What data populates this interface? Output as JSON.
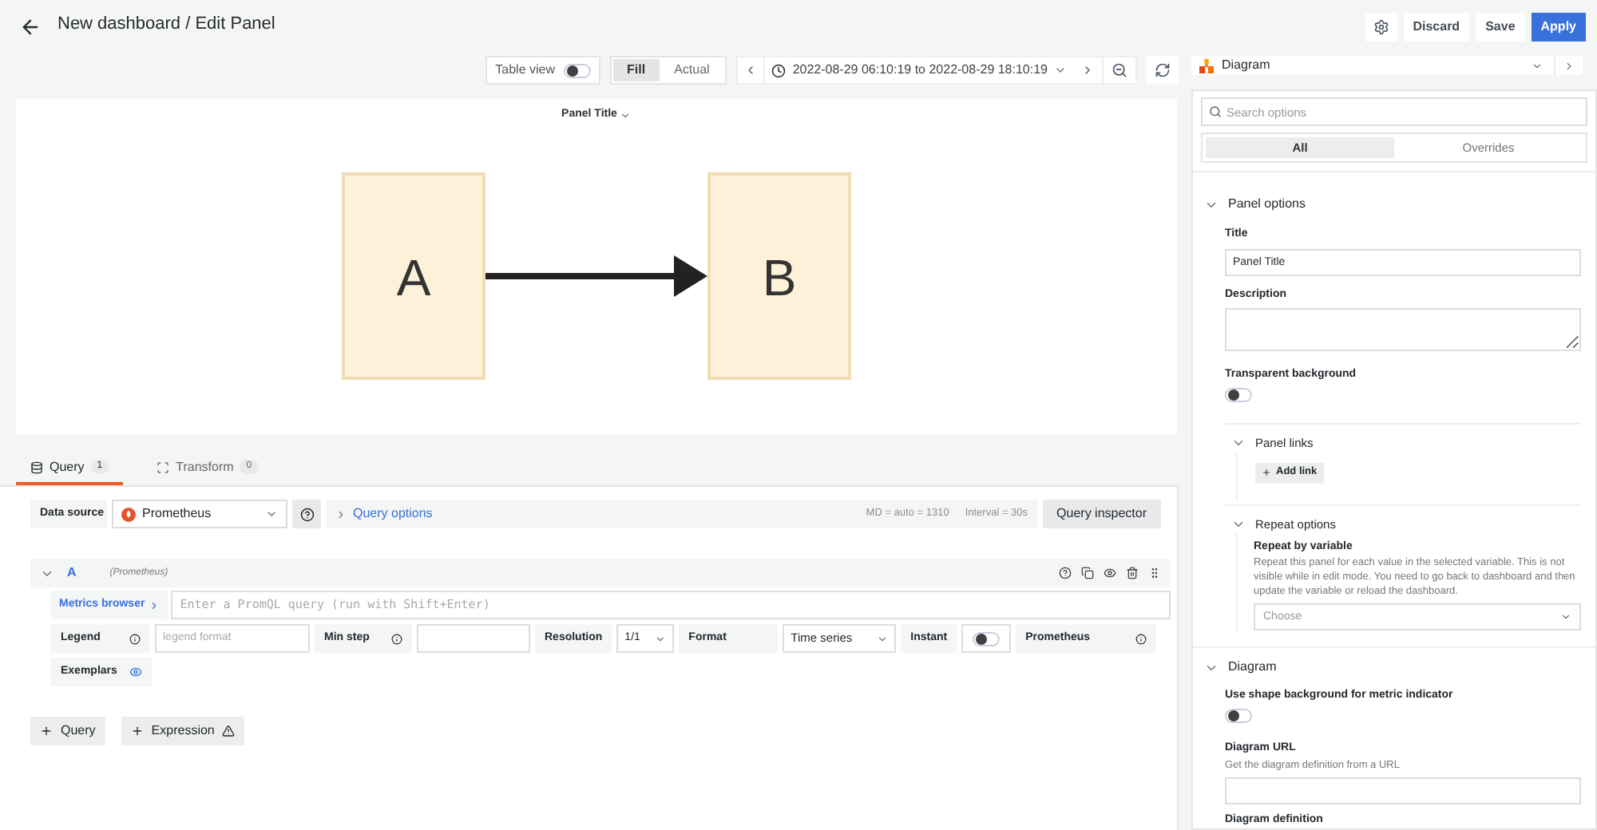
{
  "header": {
    "title": "New dashboard / Edit Panel",
    "buttons": [
      {
        "label": "Discard",
        "kind": "secondary"
      },
      {
        "label": "Save",
        "kind": "secondary"
      },
      {
        "label": "Apply",
        "kind": "primary"
      }
    ]
  },
  "toolbar": {
    "table_view": {
      "label": "Table view",
      "on": false
    },
    "fill_modes": [
      {
        "label": "Fill",
        "selected": true
      },
      {
        "label": "Actual",
        "selected": false
      }
    ],
    "time_range": "2022-08-29 06:10:19 to 2022-08-29 18:10:19"
  },
  "visualization": {
    "name": "Diagram"
  },
  "panel": {
    "title": "Panel Title",
    "nodes": [
      {
        "label": "A"
      },
      {
        "label": "B"
      }
    ]
  },
  "query_tabs": [
    {
      "label": "Query",
      "count": "1",
      "selected": true
    },
    {
      "label": "Transform",
      "count": "0",
      "selected": false
    }
  ],
  "data_source": {
    "label": "Data source",
    "value": "Prometheus",
    "query_options": "Query options",
    "md": "MD = auto = 1310",
    "interval": "Interval = 30s",
    "inspector": "Query inspector"
  },
  "query": {
    "ref": "A",
    "source": "(Prometheus)",
    "expanded": true,
    "metrics_browser": "Metrics browser",
    "placeholder": "Enter a PromQL query (run with Shift+Enter)",
    "legend": "Legend",
    "legend_placeholder": "legend format",
    "min_step": "Min step",
    "resolution": "Resolution",
    "resolution_value": "1/1",
    "format": "Format",
    "format_value": "Time series",
    "instant": {
      "label": "Instant",
      "on": false
    },
    "type": "Prometheus",
    "exemplars": {
      "label": "Exemplars",
      "on": true
    }
  },
  "add_buttons": [
    {
      "label": "Query",
      "kind": "plain"
    },
    {
      "label": "Expression",
      "kind": "warning"
    }
  ],
  "options": {
    "search_placeholder": "Search options",
    "tabs": [
      {
        "label": "All",
        "selected": true
      },
      {
        "label": "Overrides",
        "selected": false
      }
    ],
    "panel_options": {
      "title": "Panel options",
      "expanded": true,
      "title_label": "Title",
      "title_value": "Panel Title",
      "description_label": "Description",
      "transparent": {
        "label": "Transparent background",
        "on": false
      },
      "links": {
        "title": "Panel links",
        "expanded": true,
        "add": "Add link"
      },
      "repeat": {
        "title": "Repeat options",
        "expanded": true,
        "label": "Repeat by variable",
        "description": "Repeat this panel for each value in the selected variable. This is not visible while in edit mode. You need to go back to dashboard and then update the variable or reload the dashboard.",
        "placeholder": "Choose"
      }
    },
    "diagram": {
      "title": "Diagram",
      "expanded": true,
      "shape_background": {
        "label": "Use shape background for metric indicator",
        "on": false
      },
      "url_label": "Diagram URL",
      "url_description": "Get the diagram definition from a URL",
      "definition_label": "Diagram definition"
    }
  }
}
